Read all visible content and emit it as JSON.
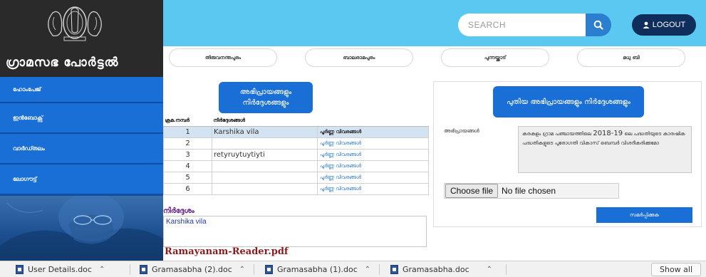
{
  "site": {
    "title": "ഗ്രാമസഭ പോർട്ടൽ"
  },
  "sidebar": {
    "items": [
      {
        "label": "ഹോംപേജ്"
      },
      {
        "label": "ഇൻബോക്സ്"
      },
      {
        "label": "വാർഡ്തലം"
      },
      {
        "label": "ലോഗൗട്ട്"
      }
    ]
  },
  "header": {
    "search_placeholder": "SEARCH",
    "logout_label": "LOGOUT"
  },
  "wards": [
    {
      "label": "തിരുവനന്തപുരം"
    },
    {
      "label": "ബാലരാമപുരം"
    },
    {
      "label": "പുന്നയ്ക്കാട്"
    },
    {
      "label": "മധു ബി"
    }
  ],
  "suggestions": {
    "heading": "അഭിപ്രായങ്ങളും നിർദ്ദേശങ്ങളും",
    "columns": [
      "ക്രമ.നമ്പർ",
      "നിർദ്ദേശങ്ങൾ",
      ""
    ],
    "rows": [
      {
        "num": "1",
        "text": "Karshika vila",
        "link": "പൂർണ്ണ വിവരങ്ങൾ"
      },
      {
        "num": "2",
        "text": "",
        "link": "പൂർണ്ണ വിവരങ്ങൾ"
      },
      {
        "num": "3",
        "text": "retyruytuytiyti",
        "link": "പൂർണ്ണ വിവരങ്ങൾ"
      },
      {
        "num": "4",
        "text": "",
        "link": "പൂർണ്ണ വിവരങ്ങൾ"
      },
      {
        "num": "5",
        "text": "",
        "link": "പൂർണ്ണ വിവരങ്ങൾ"
      },
      {
        "num": "6",
        "text": "",
        "link": "പൂർണ്ണ വിവരങ്ങൾ"
      }
    ],
    "selected_row": 1,
    "note_label": "നിർദ്ദേശം",
    "note_value": "Karshika vila",
    "pdf_link": "Ramayanam-Reader.pdf"
  },
  "new_comment": {
    "heading": "പുതിയ അഭിപ്രായങ്ങളും നിർദ്ദേശങ്ങളും",
    "comment_label": "അഭിപ്രായങ്ങൾ",
    "comment_text_pre": "കരകുളം ഗ്രാമ പഞ്ചായത്തിലെ ",
    "comment_text_year": "2018-19",
    "comment_text_post": " ലെ പദ്ധതിയുടെ കാരഷിക പദ്ധതികളുടെ പുരോഗതി വികാസ് ബെമ്പർ വിശദീകരിക്കുമോ",
    "choose_file_label": "Choose file",
    "no_file_label": "No file chosen",
    "submit_label": "സമർപ്പിക്കുക"
  },
  "downloads": {
    "items": [
      {
        "name": "User Details.doc"
      },
      {
        "name": "Gramasabha (2).doc"
      },
      {
        "name": "Gramasabha (1).doc"
      },
      {
        "name": "Gramasabha.doc"
      }
    ],
    "show_all_label": "Show all"
  }
}
